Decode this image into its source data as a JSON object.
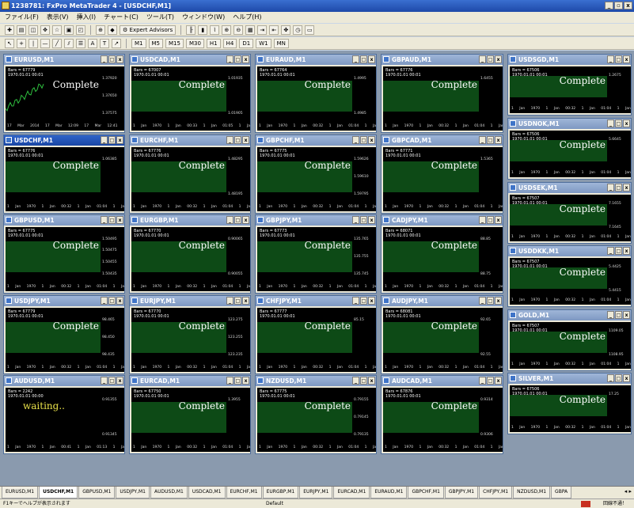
{
  "window": {
    "title": "1238781: FxPro MetaTrader 4 - [USDCHF,M1]",
    "min": "_",
    "max": "▫",
    "close": "x"
  },
  "menu": [
    "ファイル(F)",
    "表示(V)",
    "挿入(I)",
    "チャート(C)",
    "ツール(T)",
    "ウィンドウ(W)",
    "ヘルプ(H)"
  ],
  "toolbar": {
    "expert_advisors": "Expert Advisors",
    "timeframes": [
      "M1",
      "M5",
      "M15",
      "M30",
      "H1",
      "H4",
      "D1",
      "W1",
      "MN"
    ]
  },
  "chart_buttons": {
    "min": "_",
    "max": "□",
    "close": "x"
  },
  "charts": [
    {
      "symbol": "EURUSD,M1",
      "bars": "Bars = 67779",
      "date": "1970.01.01 00:01",
      "status": "Complete",
      "yticks": [
        "1.37920",
        "1.37650",
        "1.37575"
      ],
      "xticks": "17 Mar 2014  17 Mar 12:09  17 Mar 12:41",
      "active": false
    },
    {
      "symbol": "USDCAD,M1",
      "bars": "Bars = 67007",
      "date": "1970.01.01 00:01",
      "status": "Complete",
      "yticks": [
        "1.01935",
        "1.01905"
      ],
      "xticks": "1 Jan 1970  1 Jan 00:33  1 Jan 01:05  1 Jan 01:37",
      "active": false
    },
    {
      "symbol": "EURAUD,M1",
      "bars": "Bars = 67764",
      "date": "1970.01.01 00:01",
      "status": "Complete",
      "yticks": [
        "1.4995",
        "1.4985"
      ],
      "xticks": "1 Jan 1970  1 Jan 00:32  1 Jan 01:04  1 Jan 01:36",
      "active": false
    },
    {
      "symbol": "GBPAUD,M1",
      "bars": "Bars = 67776",
      "date": "1970.01.01 00:01",
      "status": "Complete",
      "yticks": [
        "1.6455"
      ],
      "xticks": "1 Jan 1970  1 Jan 00:32  1 Jan 01:04  1 Jan 01:36",
      "active": false
    },
    {
      "symbol": "USDSGD,M1",
      "bars": "Bars = 67506",
      "date": "1970.01.01 00:01",
      "status": "Complete",
      "yticks": [
        "1.2675"
      ],
      "xticks": "1 Jan 1970  1 Jan 00:32  1 Jan 01:04  1 Jan 01:36",
      "active": false
    },
    {
      "symbol": "USDCHF,M1",
      "bars": "Bars = 67776",
      "date": "1970.01.01 00:01",
      "status": "Complete",
      "yticks": [
        "1.06385"
      ],
      "xticks": "1 Jan 1970  1 Jan 00:32  1 Jan 01:04  1 Jan 01:36",
      "active": true
    },
    {
      "symbol": "EURCHF,M1",
      "bars": "Bars = 67776",
      "date": "1970.01.01 00:01",
      "status": "Complete",
      "yticks": [
        "1.48295",
        "1.48195"
      ],
      "xticks": "1 Jan 1970  1 Jan 00:32  1 Jan 01:04  1 Jan 01:36",
      "active": false
    },
    {
      "symbol": "GBPCHF,M1",
      "bars": "Bars = 67775",
      "date": "1970.01.01 00:01",
      "status": "Complete",
      "yticks": [
        "1.59626",
        "1.59610",
        "1.59795"
      ],
      "xticks": "1 Jan 1970  1 Jan 00:32  1 Jan 01:04  1 Jan 01:36",
      "active": false
    },
    {
      "symbol": "GBPCAD,M1",
      "bars": "Bars = 67771",
      "date": "1970.01.01 00:01",
      "status": "Complete",
      "yticks": [
        "1.5365"
      ],
      "xticks": "1 Jan 1970  1 Jan 00:32  1 Jan 01:04  1 Jan 01:36",
      "active": false
    },
    {
      "symbol": "USDNOK,M1",
      "bars": "Bars = 67506",
      "date": "1970.01.01 00:01",
      "status": "Complete",
      "yticks": [
        "5.6645"
      ],
      "xticks": "1 Jan 1970  1 Jan 00:32  1 Jan 01:04  1 Jan 01:36",
      "active": false
    },
    {
      "symbol": "GBPUSD,M1",
      "bars": "Bars = 67775",
      "date": "1970.01.01 00:01",
      "status": "Complete",
      "yticks": [
        "1.50495",
        "1.50475",
        "1.50455",
        "1.50435"
      ],
      "xticks": "1 Jan 1970  1 Jan 00:32  1 Jan 01:04  1 Jan 01:36",
      "active": false
    },
    {
      "symbol": "EURGBP,M1",
      "bars": "Bars = 67770",
      "date": "1970.01.01 00:01",
      "status": "Complete",
      "yticks": [
        "0.90065",
        "0.90055"
      ],
      "xticks": "1 Jan 1970  1 Jan 00:32  1 Jan 01:04  1 Jan 01:36",
      "active": false
    },
    {
      "symbol": "GBPJPY,M1",
      "bars": "Bars = 67773",
      "date": "1970.01.01 00:01",
      "status": "Complete",
      "yticks": [
        "135.765",
        "135.755",
        "135.745"
      ],
      "xticks": "1 Jan 1970  1 Jan 00:32  1 Jan 01:04  1 Jan 01:36",
      "active": false
    },
    {
      "symbol": "CADJPY,M1",
      "bars": "Bars = 68071",
      "date": "1970.01.01 00:01",
      "status": "Complete",
      "yticks": [
        "88.85",
        "88.75"
      ],
      "xticks": "1 Jan 1970  1 Jan 00:32  1 Jan 01:04  1 Jan 01:36",
      "active": false
    },
    {
      "symbol": "USDSEK,M1",
      "bars": "Bars = 67507",
      "date": "1970.01.01 00:01",
      "status": "Complete",
      "yticks": [
        "7.1655",
        "7.1645"
      ],
      "xticks": "1 Jan 1970  1 Jan 00:32  1 Jan 01:04  1 Jan 01:36",
      "active": false
    },
    {
      "symbol": "USDJPY,M1",
      "bars": "Bars = 67779",
      "date": "1970.01.01 00:01",
      "status": "Complete",
      "yticks": [
        "98.465",
        "98.450",
        "98.435"
      ],
      "xticks": "1 Jan 1970  1 Jan 00:32  1 Jan 01:04  1 Jan 01:36",
      "active": false
    },
    {
      "symbol": "EURJPY,M1",
      "bars": "Bars = 67770",
      "date": "1970.01.01 00:01",
      "status": "Complete",
      "yticks": [
        "123.275",
        "123.255",
        "123.235"
      ],
      "xticks": "1 Jan 1970  1 Jan 00:32  1 Jan 01:04  1 Jan 01:36",
      "active": false
    },
    {
      "symbol": "CHFJPY,M1",
      "bars": "Bars = 67777",
      "date": "1970.01.01 00:01",
      "status": "Complete",
      "yticks": [
        "85.15"
      ],
      "xticks": "1 Jan 1970  1 Jan 00:32  1 Jan 01:04  1 Jan 01:36",
      "active": false
    },
    {
      "symbol": "AUDJPY,M1",
      "bars": "Bars = 68081",
      "date": "1970.01.01 00:01",
      "status": "Complete",
      "yticks": [
        "92.65",
        "92.55"
      ],
      "xticks": "1 Jan 1970  1 Jan 00:32  1 Jan 01:04  1 Jan 01:36",
      "active": false
    },
    {
      "symbol": "USDDKK,M1",
      "bars": "Bars = 67507",
      "date": "1970.01.01 00:01",
      "status": "Complete",
      "yticks": [
        "5.4425",
        "5.4415"
      ],
      "xticks": "1 Jan 1970  1 Jan 00:32  1 Jan 01:04  1 Jan 01:36",
      "active": false
    },
    {
      "symbol": "AUDUSD,M1",
      "bars": "Bars = 2242",
      "date": "1970.01.01 00:00",
      "status": "waiting..",
      "yticks": [
        "0.91355",
        "0.91345"
      ],
      "xticks": "1 Jan 1970  1 Jan 00:41  1 Jan 01:13  1 Jan 01:45",
      "active": false
    },
    {
      "symbol": "EURCAD,M1",
      "bars": "Bars = 67750",
      "date": "1970.01.01 00:01",
      "status": "Complete",
      "yticks": [
        "1.3955"
      ],
      "xticks": "1 Jan 1970  1 Jan 00:32  1 Jan 01:04  1 Jan 01:36",
      "active": false
    },
    {
      "symbol": "NZDUSD,M1",
      "bars": "Bars = 67775",
      "date": "1970.01.01 00:01",
      "status": "Complete",
      "yticks": [
        "0.79155",
        "0.79145",
        "0.79135"
      ],
      "xticks": "1 Jan 1970  1 Jan 00:32  1 Jan 01:04  1 Jan 01:36",
      "active": false
    },
    {
      "symbol": "AUDCAD,M1",
      "bars": "Bars = 67876",
      "date": "1970.01.01 00:01",
      "status": "Complete",
      "yticks": [
        "0.9314",
        "0.9306"
      ],
      "xticks": "1 Jan 1970  1 Jan 00:32  1 Jan 01:04  1 Jan 01:36",
      "active": false
    },
    {
      "symbol": "GOLD,M1",
      "bars": "Bars = 67507",
      "date": "1970.01.01 00:01",
      "status": "Complete",
      "yticks": [
        "1109.05",
        "1108.95"
      ],
      "xticks": "1 Jan 1970  1 Jan 00:32  1 Jan 01:04  1 Jan 01:36",
      "active": false
    },
    {
      "symbol": "SILVER,M1",
      "bars": "Bars = 67506",
      "date": "1970.01.01 00:01",
      "status": "Complete",
      "yticks": [
        "17.25"
      ],
      "xticks": "1 Jan 1970  1 Jan 00:32  1 Jan 01:04  1 Jan 01:36",
      "active": false
    }
  ],
  "tabs": [
    "EURUSD,M1",
    "USDCHF,M1",
    "GBPUSD,M1",
    "USDJPY,M1",
    "AUDUSD,M1",
    "USDCAD,M1",
    "EURCHF,M1",
    "EURGBP,M1",
    "EURJPY,M1",
    "EURCAD,M1",
    "EURAUD,M1",
    "GBPCHF,M1",
    "GBPJPY,M1",
    "CHFJPY,M1",
    "NZDUSD,M1",
    "GBPA"
  ],
  "active_tab": 1,
  "tab_arrows": "◂ ▸",
  "status": {
    "help": "F1キーでヘルプが表示されます",
    "profile": "Default",
    "conn": "回線不通！"
  }
}
